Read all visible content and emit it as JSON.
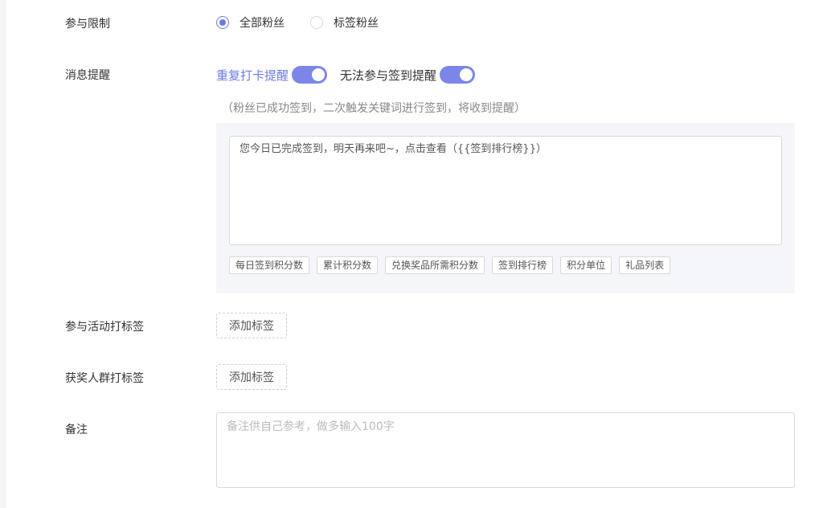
{
  "participation": {
    "label": "参与限制",
    "options": [
      {
        "label": "全部粉丝",
        "checked": true
      },
      {
        "label": "标签粉丝",
        "checked": false
      }
    ]
  },
  "reminder": {
    "label": "消息提醒",
    "switches": [
      {
        "label": "重复打卡提醒",
        "on": true,
        "active": true
      },
      {
        "label": "无法参与签到提醒",
        "on": true,
        "active": false
      }
    ],
    "hint": "（粉丝已成功签到，二次触发关键词进行签到，将收到提醒）",
    "message": "您今日已完成签到，明天再来吧~，点击查看（{{签到排行榜}}）",
    "chips": [
      "每日签到积分数",
      "累计积分数",
      "兑换奖品所需积分数",
      "签到排行榜",
      "积分单位",
      "礼品列表"
    ]
  },
  "activity_tag": {
    "label": "参与活动打标签",
    "button": "添加标签"
  },
  "winner_tag": {
    "label": "获奖人群打标签",
    "button": "添加标签"
  },
  "remark": {
    "label": "备注",
    "placeholder": "备注供自己参考，做多输入100字",
    "value": ""
  },
  "colors": {
    "accent": "#6b7ae6",
    "switch_on": "#7c86e8",
    "panel_bg": "#f5f6f9"
  }
}
